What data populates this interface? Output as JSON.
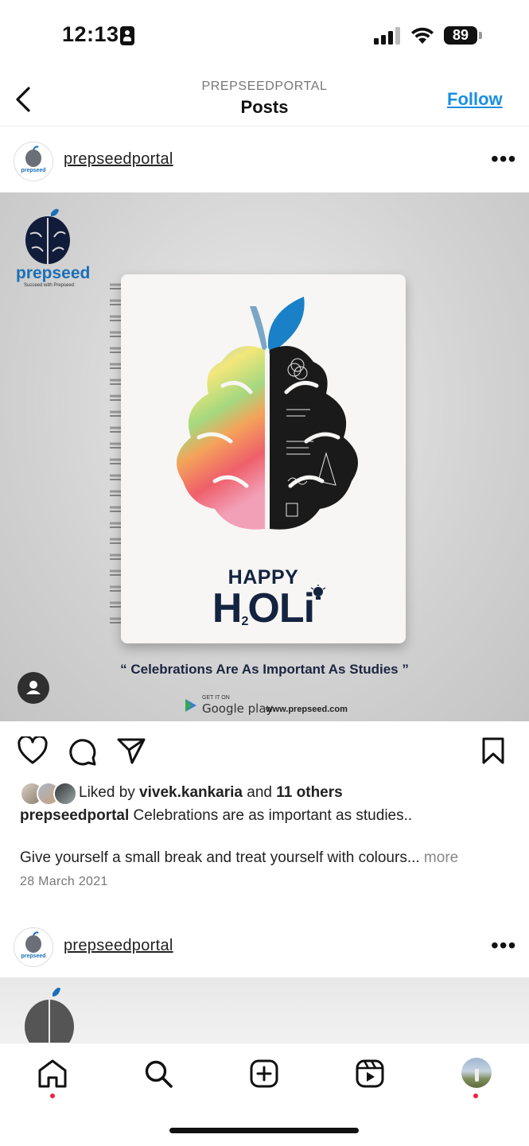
{
  "status_bar": {
    "time": "12:13",
    "battery": "89"
  },
  "header": {
    "account": "PREPSEEDPORTAL",
    "title": "Posts",
    "follow_label": "Follow"
  },
  "post": {
    "username": "prepseedportal",
    "image": {
      "brand": "prepseed",
      "brand_tagline": "Succeed with Prepseed",
      "happy": "HAPPY",
      "holi": "H",
      "holi_sub": "2",
      "holi_end": "OLi",
      "quote": "“ Celebrations Are As Important As Studies ”",
      "get_it_on": "GET IT ON",
      "store": "Google play",
      "url": "www.prepseed.com"
    },
    "likes": {
      "prefix": "Liked by ",
      "user": "vivek.kankaria",
      "middle": " and ",
      "others": "11 others"
    },
    "caption_user": "prepseedportal",
    "caption_text": " Celebrations are as important as studies..",
    "caption_line2": "Give yourself a small break and treat yourself with colours...",
    "more_label": " more",
    "date": "28 March 2021"
  },
  "next_post": {
    "username": "prepseedportal"
  },
  "tabbar": {
    "items": [
      "home-icon",
      "search-icon",
      "create-icon",
      "reels-icon",
      "profile-avatar"
    ]
  },
  "colors": {
    "accent": "#1a8fe0",
    "notification_dot": "#e8253a",
    "brand_navy": "#132340",
    "brand_blue": "#1a6fb8"
  }
}
